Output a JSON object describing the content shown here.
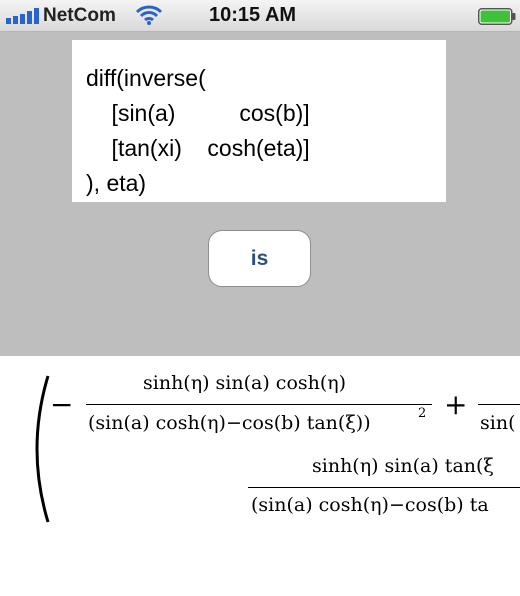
{
  "status_bar": {
    "carrier": "NetCom",
    "time": "10:15 AM",
    "signal_bars": 5,
    "icons": [
      "signal-icon",
      "wifi-icon",
      "battery-icon"
    ],
    "battery_color": "#3fc23a"
  },
  "input": {
    "lines": [
      "diff(inverse(",
      "    [sin(a)          cos(b)]",
      "    [tan(xi)    cosh(eta)]",
      "), eta)"
    ]
  },
  "is_button": {
    "label": "is",
    "color": "#2f4f82"
  },
  "output": {
    "term1": {
      "sign": "−",
      "numerator": "sinh(η) sin(a) cosh(η)",
      "denominator": "(sin(a) cosh(η)−cos(b) tan(ξ))",
      "exponent": "2"
    },
    "plus": "+",
    "term2_denominator_clip": "sin(",
    "term3": {
      "numerator": "sinh(η) sin(a) tan(ξ",
      "denominator": "(sin(a) cosh(η)−cos(b) ta"
    }
  },
  "colors": {
    "input_area_bg": "#bebebe",
    "status_bar_bg": "#e6e6e6"
  }
}
